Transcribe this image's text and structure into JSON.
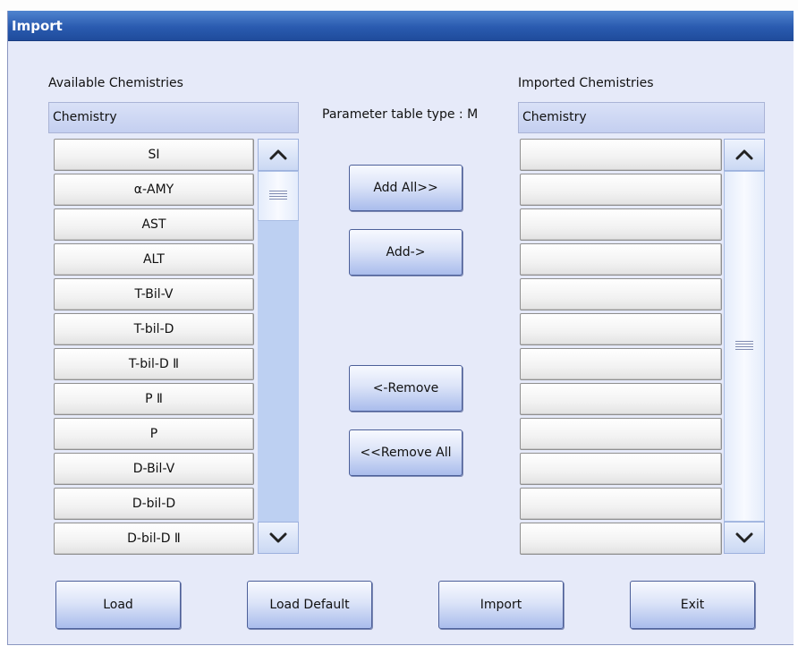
{
  "window": {
    "title": "Import"
  },
  "available": {
    "label": "Available Chemistries",
    "header": "Chemistry",
    "items": [
      "SI",
      "α-AMY",
      "AST",
      "ALT",
      "T-Bil-V",
      "T-bil-D",
      "T-bil-D Ⅱ",
      "P Ⅱ",
      "P",
      "D-Bil-V",
      "D-bil-D",
      "D-bil-D Ⅱ"
    ]
  },
  "imported": {
    "label": "Imported Chemistries",
    "header": "Chemistry",
    "items": [
      "",
      "",
      "",
      "",
      "",
      "",
      "",
      "",
      "",
      "",
      "",
      ""
    ]
  },
  "param_type": "Parameter table type : M",
  "actions": {
    "add_all": "Add All>>",
    "add": "Add->",
    "remove": "<-Remove",
    "remove_all": "<<Remove All"
  },
  "footer": {
    "load": "Load",
    "load_default": "Load Default",
    "import": "Import",
    "exit": "Exit"
  },
  "icons": {
    "scroll_up": "chevron-up-icon",
    "scroll_down": "chevron-down-icon",
    "scroll_grip": "grip-icon"
  },
  "colors": {
    "titlebar": "#2a5bb0",
    "dialog_bg": "#e6eaf9",
    "scroll_track": "#bdd0f2"
  }
}
